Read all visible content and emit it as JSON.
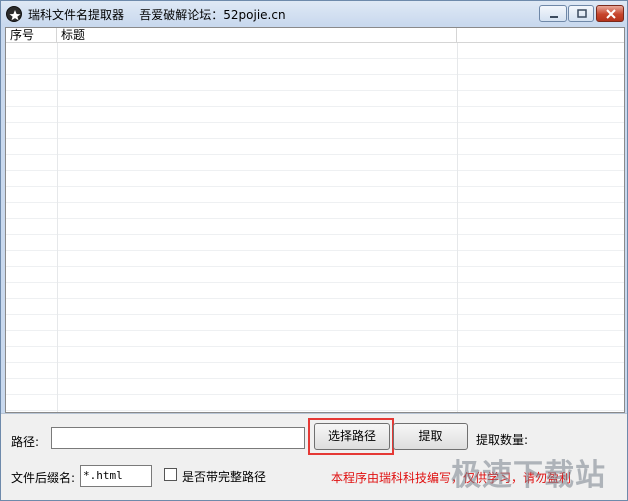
{
  "window": {
    "title": "瑞科文件名提取器    吾爱破解论坛：52pojie.cn"
  },
  "list": {
    "columns": [
      "序号",
      "标题"
    ]
  },
  "form": {
    "path_label": "路径:",
    "path_value": "",
    "choose_path_button": "选择路径",
    "extract_button": "提取",
    "count_label": "提取数量:",
    "ext_label": "文件后缀名:",
    "ext_value": "*.html",
    "full_path_checkbox_label": "是否带完整路径",
    "full_path_checked": false,
    "credit_text": "本程序由瑞科科技编写，仅供学习，请勿盈利"
  },
  "watermark": "极速下载站",
  "colors": {
    "highlight": "#e53935",
    "credit": "#e01010"
  }
}
